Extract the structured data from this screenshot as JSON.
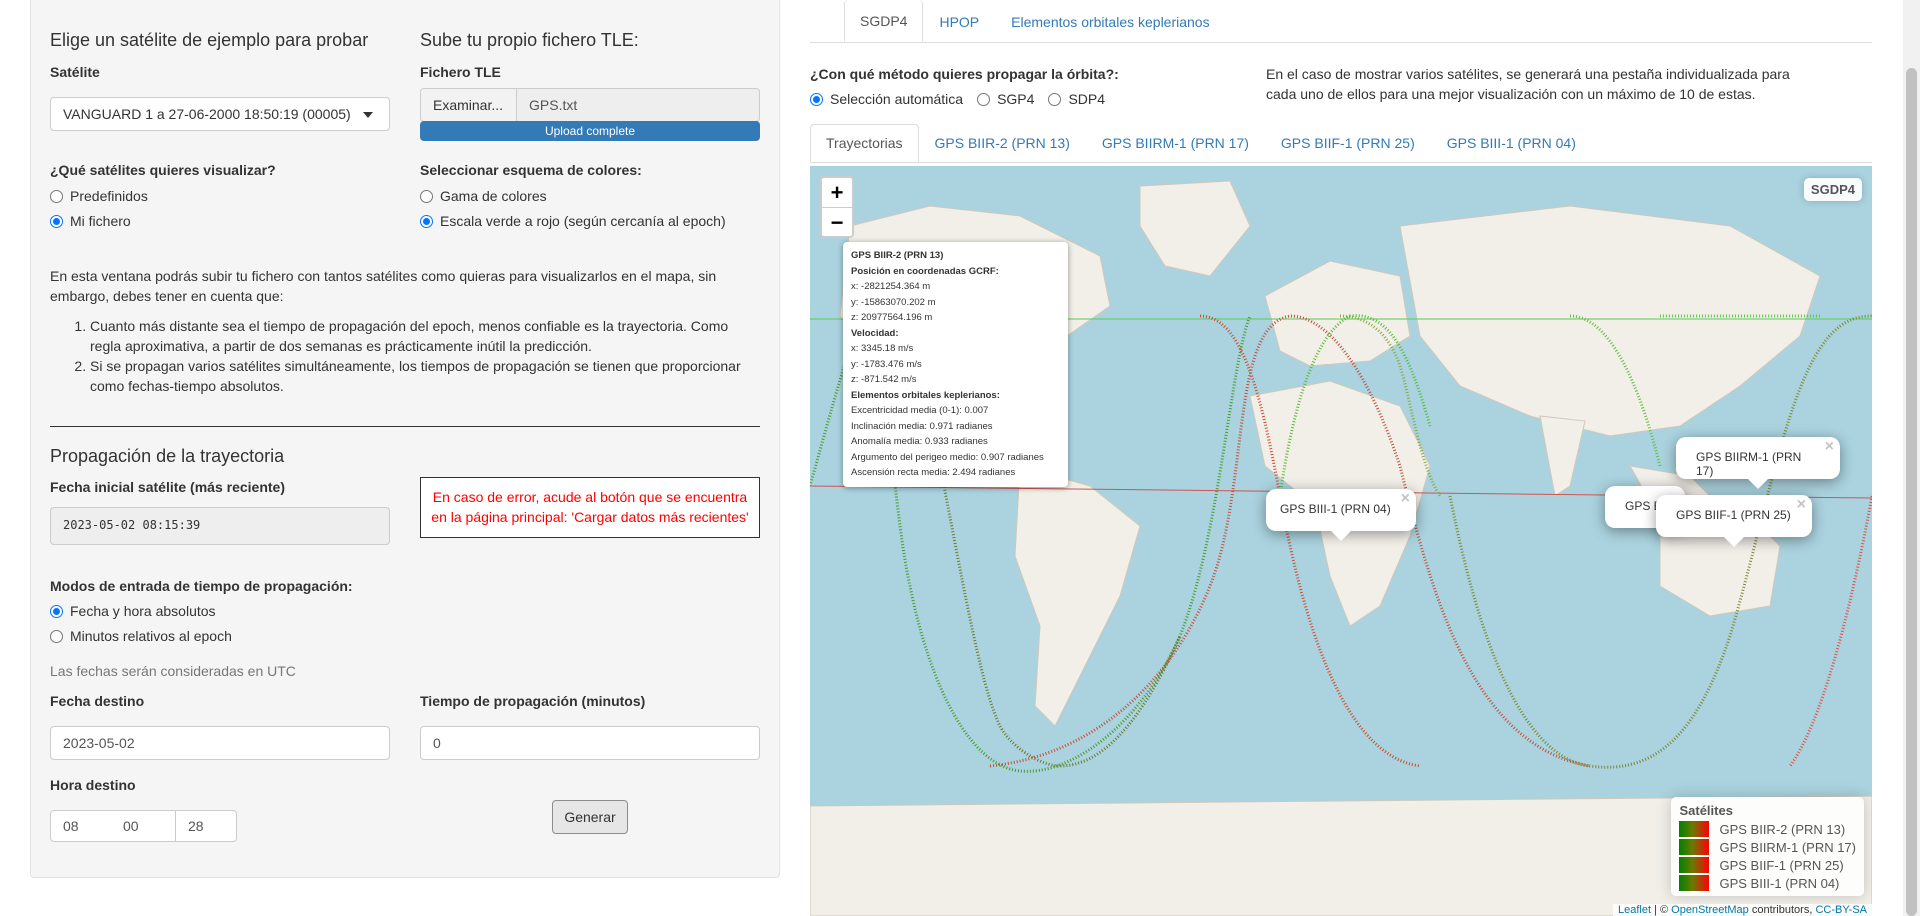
{
  "sample": {
    "heading": "Elige un satélite de ejemplo para probar",
    "satellite_label": "Satélite",
    "satellite_value": "VANGUARD 1 a 27-06-2000 18:50:19 (00005)"
  },
  "upload": {
    "heading": "Sube tu propio fichero TLE:",
    "file_label": "Fichero TLE",
    "browse_label": "Examinar...",
    "file_name": "GPS.txt",
    "progress_text": "Upload complete",
    "progress_fraction": 1.0
  },
  "which_sats": {
    "label": "¿Qué satélites quieres visualizar?",
    "options": [
      "Predefinidos",
      "Mi fichero"
    ],
    "selected": "Mi fichero"
  },
  "color_scheme": {
    "label": "Seleccionar esquema de colores:",
    "options": [
      "Gama de colores",
      "Escala verde a rojo (según cercanía al epoch)"
    ],
    "selected": "Escala verde a rojo (según cercanía al epoch)"
  },
  "info": {
    "intro": "En esta ventana podrás subir tu fichero con tantos satélites como quieras para visualizarlos en el mapa, sin embargo, debes tener en cuenta que:",
    "points": [
      "Cuanto más distante sea el tiempo de propagación del epoch, menos confiable es la trayectoria. Como regla aproximativa, a partir de dos semanas es prácticamente inútil la predicción.",
      "Si se propagan varios satélites simultáneamente, los tiempos de propagación se tienen que proporcionar como fechas-tiempo absolutos."
    ]
  },
  "propagation": {
    "heading": "Propagación de la trayectoria",
    "initial_date_label": "Fecha inicial satélite (más reciente)",
    "initial_date_value": "2023-05-02 08:15:39",
    "error_text": "En caso de error, acude al botón que se encuentra en la página principal: 'Cargar datos más recientes'",
    "mode_label": "Modos de entrada de tiempo de propagación:",
    "mode_options": [
      "Fecha y hora absolutos",
      "Minutos relativos al epoch"
    ],
    "mode_selected": "Fecha y hora absolutos",
    "utc_note": "Las fechas serán consideradas en UTC",
    "dest_date_label": "Fecha destino",
    "dest_date_value": "2023-05-02",
    "prop_time_label": "Tiempo de propagación (minutos)",
    "prop_time_value": "0",
    "dest_hour_label": "Hora destino",
    "hour": "08",
    "minute": "00",
    "second": "28",
    "generate_label": "Generar"
  },
  "right": {
    "model_tabs": [
      "SGDP4",
      "HPOP",
      "Elementos orbitales keplerianos"
    ],
    "active_model_tab": "SGDP4",
    "method_label": "¿Con qué método quieres propagar la órbita?:",
    "method_options": [
      "Selección automática",
      "SGP4",
      "SDP4"
    ],
    "method_selected": "Selección automática",
    "note": "En el caso de mostrar varios satélites, se generará una pestaña individualizada para cada uno de ellos para una mejor visualización con un máximo de 10 de estas.",
    "sat_tabs": [
      "Trayectorias",
      "GPS BIIR-2 (PRN 13)",
      "GPS BIIRM-1 (PRN 17)",
      "GPS BIIF-1 (PRN 25)",
      "GPS BIII-1 (PRN 04)"
    ],
    "active_sat_tab": "Trayectorias"
  },
  "map": {
    "zoom_in": "+",
    "zoom_out": "−",
    "badge": "SGDP4",
    "info_popup": {
      "title": "GPS BIIR-2 (PRN 13)",
      "pos_heading": "Posición en coordenadas GCRF:",
      "x": "x: -2821254.364 m",
      "y": "y: -15863070.202 m",
      "z": "z: 20977564.196 m",
      "vel_heading": "Velocidad:",
      "vx": "x: 3345.18 m/s",
      "vy": "y: -1783.476 m/s",
      "vz": "z: -871.542 m/s",
      "kep_heading": "Elementos orbitales keplerianos:",
      "ecc": "Excentricidad media (0-1): 0.007",
      "inc": "Inclinación media: 0.971 radianes",
      "anom": "Anomalía media: 0.933 radianes",
      "perigee": "Argumento del perigeo medio: 0.907 radianes",
      "raan": "Ascensión recta media: 2.494 radianes"
    },
    "popups": [
      "GPS BIII-1 (PRN 04)",
      "GPS BIIRM-1 (PRN 17)",
      "GPS B",
      "GPS BIIF-1 (PRN 25)"
    ],
    "close_glyph": "×",
    "legend_title": "Satélites",
    "legend_items": [
      "GPS BIIR-2 (PRN 13)",
      "GPS BIIRM-1 (PRN 17)",
      "GPS BIIF-1 (PRN 25)",
      "GPS BIII-1 (PRN 04)"
    ],
    "attrib_leaflet": "Leaflet",
    "attrib_sep": " | © ",
    "attrib_osm": "OpenStreetMap",
    "attrib_mid": " contributors, ",
    "attrib_cc": "CC-BY-SA",
    "colors": {
      "ocean": "#aad3df",
      "land": "#f2efe9",
      "near_epoch": "#008000",
      "far_epoch": "#ff0000"
    }
  }
}
